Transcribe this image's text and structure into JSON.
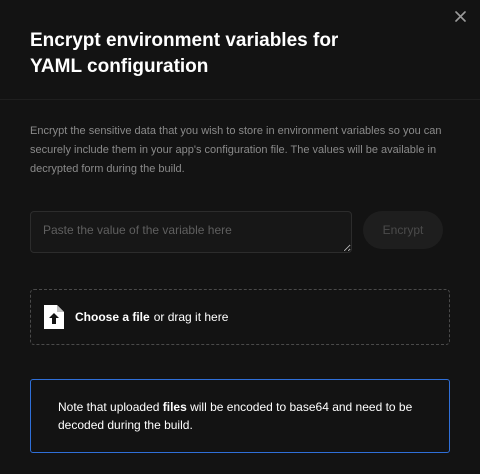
{
  "modal": {
    "title": "Encrypt environment variables for YAML configuration",
    "close_icon": "close-icon"
  },
  "description": "Encrypt the sensitive data that you wish to store in environment variables so you can securely include them in your app's configuration file. The values will be available in decrypted form during the build.",
  "encrypt": {
    "placeholder": "Paste the value of the variable here",
    "button_label": "Encrypt"
  },
  "dropzone": {
    "icon": "file-upload-icon",
    "link_text": "Choose a file",
    "rest_text": "or drag it here"
  },
  "note": {
    "prefix": "Note that uploaded ",
    "emphasis": "files",
    "suffix": " will be encoded to base64 and need to be decoded during the build."
  },
  "colors": {
    "background": "#131313",
    "note_border": "#2f6fd8"
  }
}
